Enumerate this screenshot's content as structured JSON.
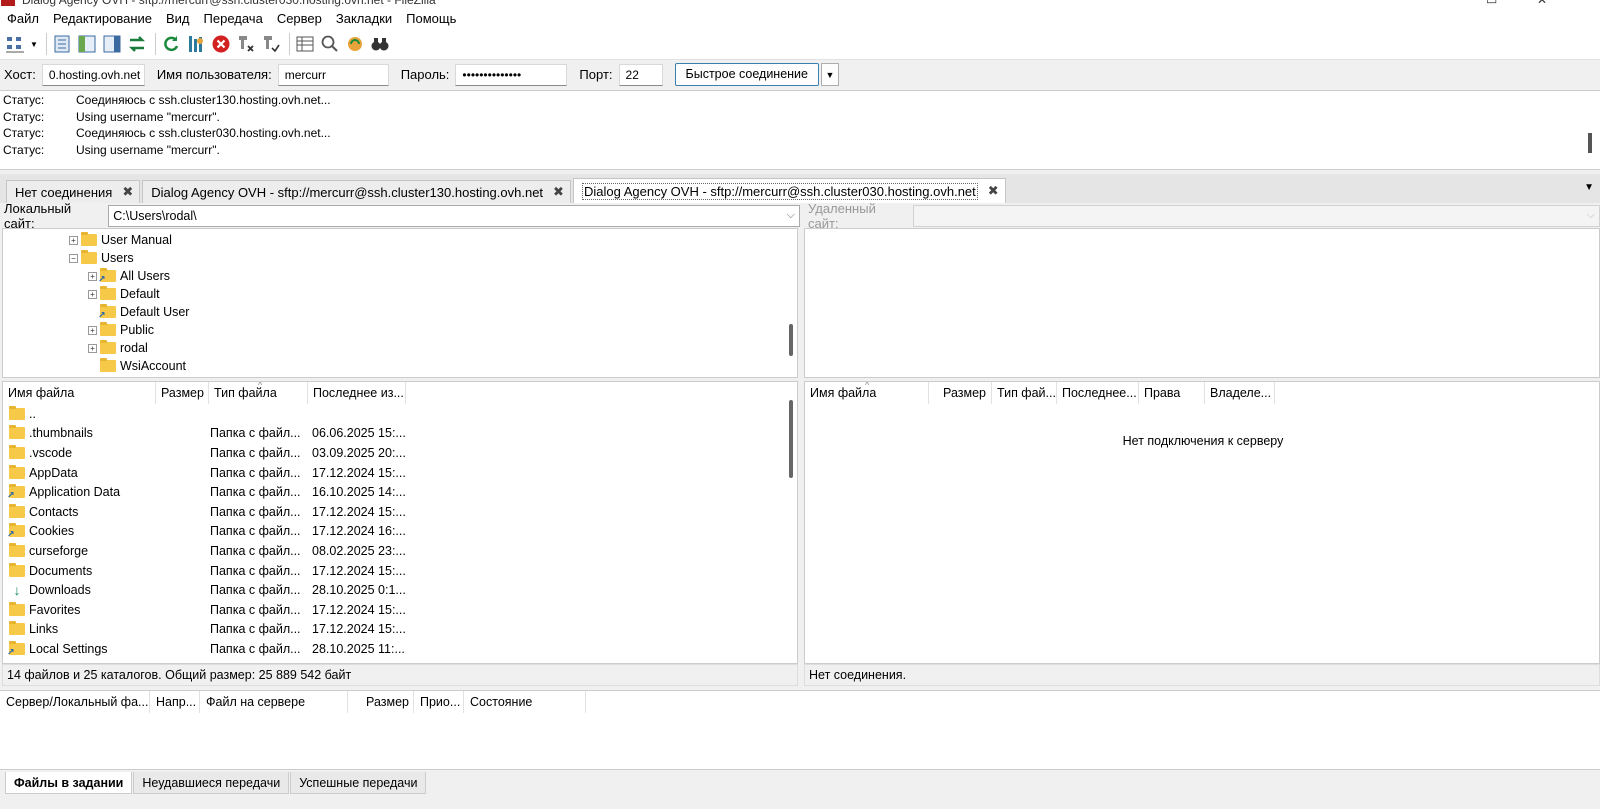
{
  "window": {
    "title": "Dialog Agency OVH - sftp://mercurr@ssh.cluster030.hosting.ovh.net - FileZilla"
  },
  "menu": [
    "Файл",
    "Редактирование",
    "Вид",
    "Передача",
    "Сервер",
    "Закладки",
    "Помощь"
  ],
  "toolbar": {
    "icons": [
      "site-manager-icon",
      "dropdown-icon",
      "message-log-icon",
      "local-tree-icon",
      "remote-tree-icon",
      "transfer-queue-icon",
      "refresh-icon",
      "process-queue-icon",
      "cancel-icon",
      "disconnect-icon",
      "reconnect-icon",
      "directory-listing-filters-icon",
      "toggle-compare-icon",
      "sync-browsing-icon",
      "search-icon"
    ]
  },
  "quickconnect": {
    "host_label": "Хост:",
    "host_value": "0.hosting.ovh.net",
    "user_label": "Имя пользователя:",
    "user_value": "mercurr",
    "pass_label": "Пароль:",
    "pass_value": "••••••••••••••",
    "port_label": "Порт:",
    "port_value": "22",
    "connect_label": "Быстрое соединение"
  },
  "log": [
    {
      "label": "Статус:",
      "text": "Соединяюсь с ssh.cluster130.hosting.ovh.net..."
    },
    {
      "label": "Статус:",
      "text": "Using username \"mercurr\"."
    },
    {
      "label": "Статус:",
      "text": "Соединяюсь с ssh.cluster030.hosting.ovh.net..."
    },
    {
      "label": "Статус:",
      "text": "Using username \"mercurr\"."
    }
  ],
  "tabs": [
    {
      "label": "Нет соединения"
    },
    {
      "label": "Dialog Agency OVH - sftp://mercurr@ssh.cluster130.hosting.ovh.net"
    },
    {
      "label": "Dialog Agency OVH - sftp://mercurr@ssh.cluster030.hosting.ovh.net"
    }
  ],
  "local": {
    "site_label": "Локальный сайт:",
    "site_path": "C:\\Users\\rodal\\",
    "tree": [
      {
        "label": "User Manual",
        "expander": "+",
        "link": false
      },
      {
        "label": "Users",
        "expander": "−",
        "link": false
      },
      {
        "label": "All Users",
        "expander": "+",
        "link": true
      },
      {
        "label": "Default",
        "expander": "+",
        "link": false
      },
      {
        "label": "Default User",
        "expander": "",
        "link": true
      },
      {
        "label": "Public",
        "expander": "+",
        "link": false
      },
      {
        "label": "rodal",
        "expander": "+",
        "link": false
      },
      {
        "label": "WsiAccount",
        "expander": "",
        "link": false
      }
    ],
    "columns": {
      "name": "Имя файла",
      "size": "Размер",
      "type": "Тип файла",
      "modified": "Последнее из..."
    },
    "files": [
      {
        "name": "..",
        "type": "",
        "date": "",
        "icon": "folder"
      },
      {
        "name": ".thumbnails",
        "type": "Папка с файл...",
        "date": "06.06.2025 15:...",
        "icon": "folder"
      },
      {
        "name": ".vscode",
        "type": "Папка с файл...",
        "date": "03.09.2025 20:...",
        "icon": "folder"
      },
      {
        "name": "AppData",
        "type": "Папка с файл...",
        "date": "17.12.2024 15:...",
        "icon": "folder"
      },
      {
        "name": "Application Data",
        "type": "Папка с файл...",
        "date": "16.10.2025 14:...",
        "icon": "link"
      },
      {
        "name": "Contacts",
        "type": "Папка с файл...",
        "date": "17.12.2024 15:...",
        "icon": "folder"
      },
      {
        "name": "Cookies",
        "type": "Папка с файл...",
        "date": "17.12.2024 16:...",
        "icon": "link"
      },
      {
        "name": "curseforge",
        "type": "Папка с файл...",
        "date": "08.02.2025 23:...",
        "icon": "folder"
      },
      {
        "name": "Documents",
        "type": "Папка с файл...",
        "date": "17.12.2024 15:...",
        "icon": "folder"
      },
      {
        "name": "Downloads",
        "type": "Папка с файл...",
        "date": "28.10.2025 0:1...",
        "icon": "download"
      },
      {
        "name": "Favorites",
        "type": "Папка с файл...",
        "date": "17.12.2024 15:...",
        "icon": "folder"
      },
      {
        "name": "Links",
        "type": "Папка с файл...",
        "date": "17.12.2024 15:...",
        "icon": "folder"
      },
      {
        "name": "Local Settings",
        "type": "Папка с файл...",
        "date": "28.10.2025 11:...",
        "icon": "link"
      }
    ],
    "status": "14 файлов и 25 каталогов. Общий размер: 25 889 542 байт"
  },
  "remote": {
    "site_label": "Удаленный сайт:",
    "columns": {
      "name": "Имя файла",
      "size": "Размер",
      "type": "Тип фай...",
      "modified": "Последнее...",
      "perms": "Права",
      "owner": "Владеле..."
    },
    "empty_message": "Нет подключения к серверу",
    "status": "Нет соединения."
  },
  "queue": {
    "columns": {
      "server": "Сервер/Локальный фа...",
      "direction": "Напр...",
      "remote_file": "Файл на сервере",
      "size": "Размер",
      "priority": "Прио...",
      "state": "Состояние"
    }
  },
  "bottom_tabs": [
    "Файлы в задании",
    "Неудавшиеся передачи",
    "Успешные передачи"
  ]
}
